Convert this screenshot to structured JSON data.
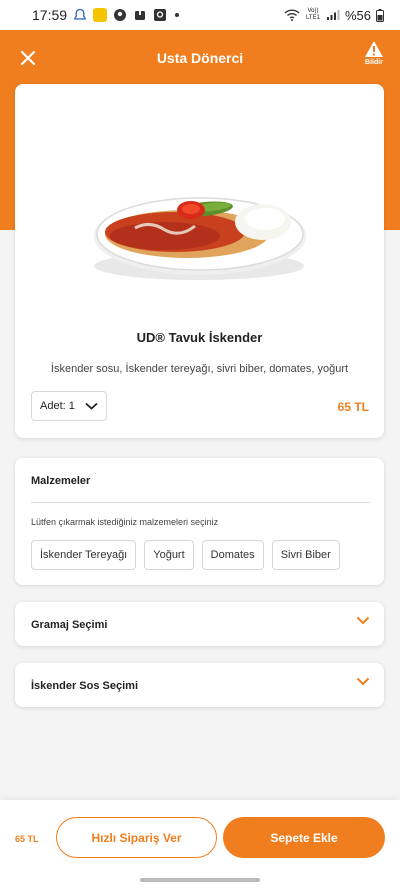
{
  "status_bar": {
    "time": "17:59",
    "network": "Vo)) LTE1",
    "battery": "%56"
  },
  "header": {
    "title": "Usta Dönerci",
    "report_label": "Bildir"
  },
  "product": {
    "name": "UD® Tavuk İskender",
    "description": "İskender sosu, İskender tereyağı, sivri biber, domates, yoğurt",
    "quantity_label": "Adet:",
    "quantity_value": "1",
    "price": "65 TL"
  },
  "ingredients": {
    "title": "Malzemeler",
    "subtitle": "Lütfen çıkarmak istediğiniz malzemeleri seçiniz",
    "items": [
      "İskender Tereyağı",
      "Yoğurt",
      "Domates",
      "Sivri Biber"
    ]
  },
  "options": [
    {
      "title": "Gramaj Seçimi"
    },
    {
      "title": "İskender Sos Seçimi"
    }
  ],
  "bottom_bar": {
    "price": "65 TL",
    "quick_order_label": "Hızlı Sipariş Ver",
    "add_to_cart_label": "Sepete Ekle"
  },
  "colors": {
    "accent": "#f07e1e"
  }
}
